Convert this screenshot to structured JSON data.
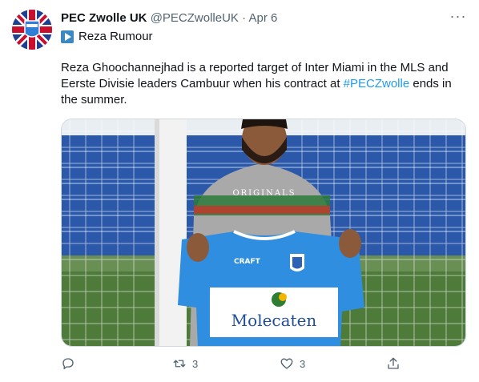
{
  "tweet": {
    "display_name": "PEC Zwolle UK",
    "handle": "@PECZwolleUK",
    "separator": "·",
    "date": "Apr 6",
    "more_label": "···",
    "subtitle": "Reza Rumour",
    "text_part1": "Reza Ghoochannejhad is a reported target of Inter Miami in the MLS and Eerste Divisie leaders Cambuur when his contract at ",
    "hashtag": "#PECZwolle",
    "text_part2": " ends in the summer.",
    "image_alt_texts": {
      "hoodie": "ORIGINALS",
      "shirt_brand": "CRAFT",
      "sponsor": "Molecaten"
    },
    "actions": {
      "reply_count": "",
      "retweet_count": "3",
      "like_count": "3"
    }
  },
  "colors": {
    "link": "#1d9bf0",
    "muted": "#536471",
    "shirt_blue": "#2f8ee0"
  },
  "icons": [
    "reply-icon",
    "retweet-icon",
    "like-icon",
    "share-icon",
    "play-badge-icon",
    "more-icon"
  ]
}
